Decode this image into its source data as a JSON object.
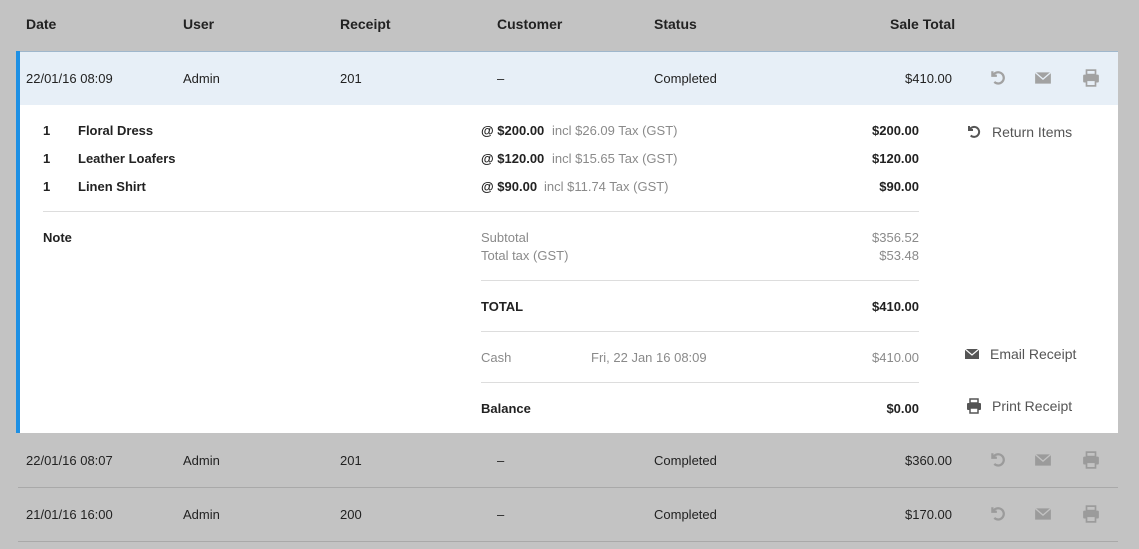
{
  "header": {
    "date": "Date",
    "user": "User",
    "receipt": "Receipt",
    "customer": "Customer",
    "status": "Status",
    "sale_total": "Sale Total"
  },
  "sales": [
    {
      "date": "22/01/16 08:09",
      "user": "Admin",
      "receipt": "201",
      "customer": "–",
      "status": "Completed",
      "total": "$410.00"
    },
    {
      "date": "22/01/16 08:07",
      "user": "Admin",
      "receipt": "201",
      "customer": "–",
      "status": "Completed",
      "total": "$360.00"
    },
    {
      "date": "21/01/16 16:00",
      "user": "Admin",
      "receipt": "200",
      "customer": "–",
      "status": "Completed",
      "total": "$170.00"
    }
  ],
  "detail": {
    "items": [
      {
        "qty": "1",
        "name": "Floral Dress",
        "unit_price": "@ $200.00",
        "tax": "incl $26.09 Tax (GST)",
        "line_total": "$200.00"
      },
      {
        "qty": "1",
        "name": "Leather Loafers",
        "unit_price": "@ $120.00",
        "tax": "incl $15.65 Tax (GST)",
        "line_total": "$120.00"
      },
      {
        "qty": "1",
        "name": "Linen Shirt",
        "unit_price": "@ $90.00",
        "tax": "incl $11.74 Tax (GST)",
        "line_total": "$90.00"
      }
    ],
    "note_label": "Note",
    "subtotal_label": "Subtotal",
    "subtotal_value": "$356.52",
    "tax_label": "Total tax (GST)",
    "tax_value": "$53.48",
    "total_label": "TOTAL",
    "total_value": "$410.00",
    "payment_method": "Cash",
    "payment_date": "Fri, 22 Jan 16 08:09",
    "payment_amount": "$410.00",
    "balance_label": "Balance",
    "balance_value": "$0.00"
  },
  "actions": {
    "return_items": "Return Items",
    "email_receipt": "Email Receipt",
    "print_receipt": "Print Receipt"
  },
  "icons": {
    "return": "undo-icon",
    "email": "envelope-icon",
    "print": "printer-icon"
  },
  "colors": {
    "accent": "#1e90e4",
    "active_row": "#e7eff7",
    "background": "#c3c3c3"
  }
}
